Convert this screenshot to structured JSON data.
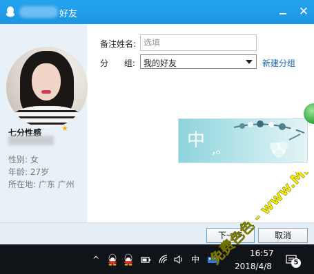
{
  "titlebar": {
    "title": "好友",
    "minimize_icon": "minimize-icon",
    "close_icon": "close-icon",
    "close_glyph": "✕"
  },
  "profile": {
    "nickname": "七分性感",
    "gender": "性别: 女",
    "age": "年龄: 27岁",
    "location": "所在地: 广东  广州"
  },
  "form": {
    "remark_label": "备注姓名:",
    "remark_placeholder": "选填",
    "group_label": "分      组:",
    "group_value": "我的好友",
    "new_group_link": "新建分组"
  },
  "ad": {
    "text": "中",
    "mark": ",。"
  },
  "buttons": {
    "next": "下一步",
    "cancel": "取消"
  },
  "taskbar": {
    "ime": "中",
    "time": "16:57",
    "date": "2018/4/8",
    "notification_count": "5"
  },
  "watermark": {
    "text": "免费色色 - www.MFsese.com"
  },
  "colors": {
    "titlebar": "#1c95e3",
    "link": "#1e6bb8",
    "watermark": "#f7ef00"
  }
}
